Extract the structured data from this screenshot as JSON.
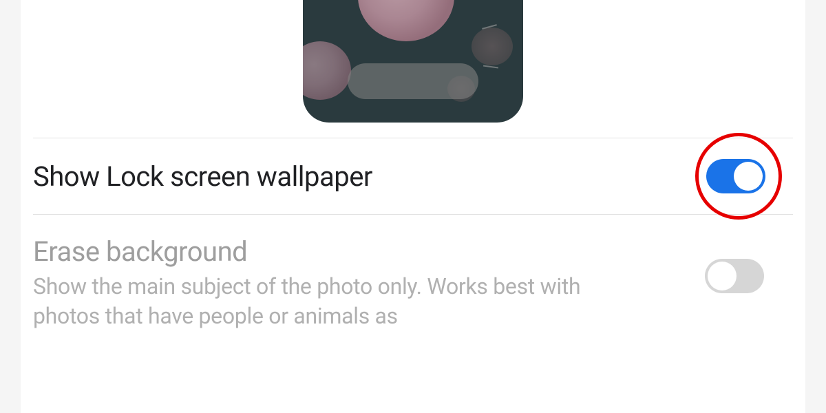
{
  "settings": {
    "showLockScreen": {
      "label": "Show Lock screen wallpaper",
      "enabled": true
    },
    "eraseBackground": {
      "label": "Erase background",
      "description": "Show the main subject of the photo only. Works best with photos that have people or animals as",
      "enabled": false
    }
  },
  "annotation": {
    "highlight": "red-circle"
  },
  "colors": {
    "toggleOn": "#1a73e8",
    "toggleOff": "#d6d6d6",
    "highlight": "#e60000"
  }
}
